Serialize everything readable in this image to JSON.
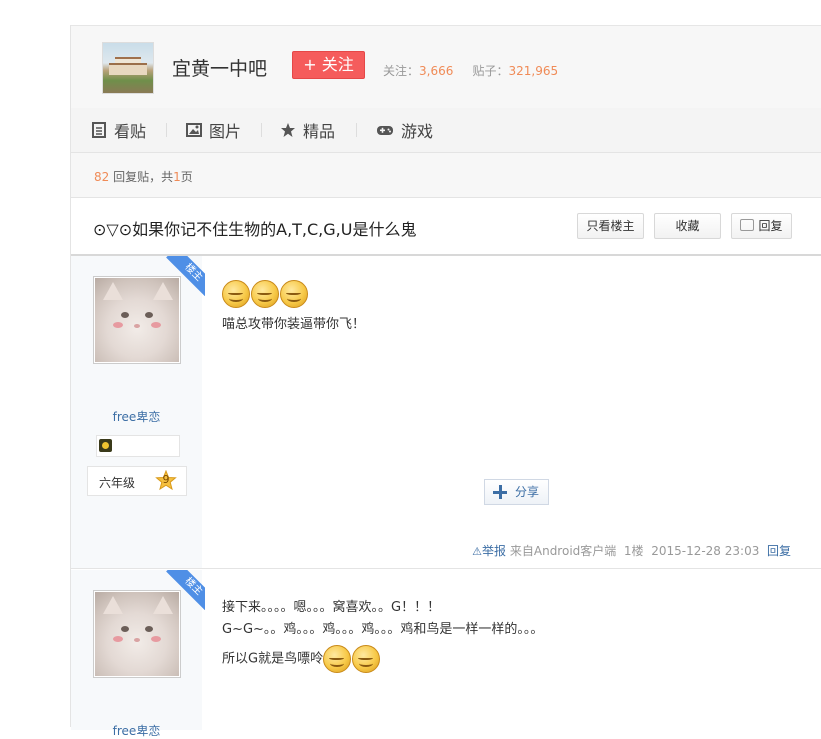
{
  "forum": {
    "name": "宜黄一中吧",
    "follow_label": "+ 关注",
    "followers_label": "关注：",
    "followers_count": "3,666",
    "posts_label": "贴子：",
    "posts_count": "321,965"
  },
  "tabs": [
    {
      "label": "看贴",
      "icon": "document-icon"
    },
    {
      "label": "图片",
      "icon": "image-icon"
    },
    {
      "label": "精品",
      "icon": "star-icon"
    },
    {
      "label": "游戏",
      "icon": "gamepad-icon"
    }
  ],
  "reply_bar": {
    "count": "82",
    "mid": " 回复贴，共",
    "pages": "1",
    "suffix": "页"
  },
  "thread": {
    "title": "⊙▽⊙如果你记不住生物的A,T,C,G,U是什么鬼",
    "only_op_label": "只看楼主",
    "favorite_label": "收藏",
    "reply_label": "回复"
  },
  "posts": [
    {
      "badge": "楼主",
      "username": "free卑恋",
      "level_title": "六年级",
      "level_num": "9",
      "lines": [
        "喵总攻带你装逼带你飞！"
      ],
      "share_label": "分享",
      "report_label": "举报",
      "source": "来自Android客户端",
      "floor": "1楼",
      "time": "2015-12-28 23:03",
      "reply_label": "回复"
    },
    {
      "badge": "楼主",
      "username": "free卑恋",
      "lines": [
        "接下来。。。。嗯。。。窝喜欢。。G！！！",
        "G~G~。。鸡。。。鸡。。。鸡。。。鸡和鸟是一样一样的。。。",
        "所以G就是鸟嘌呤"
      ]
    }
  ],
  "colors": {
    "follow_button": "#f55c5c",
    "accent_orange": "#f08b57",
    "link_blue": "#3c6ea5",
    "badge_blue": "#4f8fe6"
  }
}
